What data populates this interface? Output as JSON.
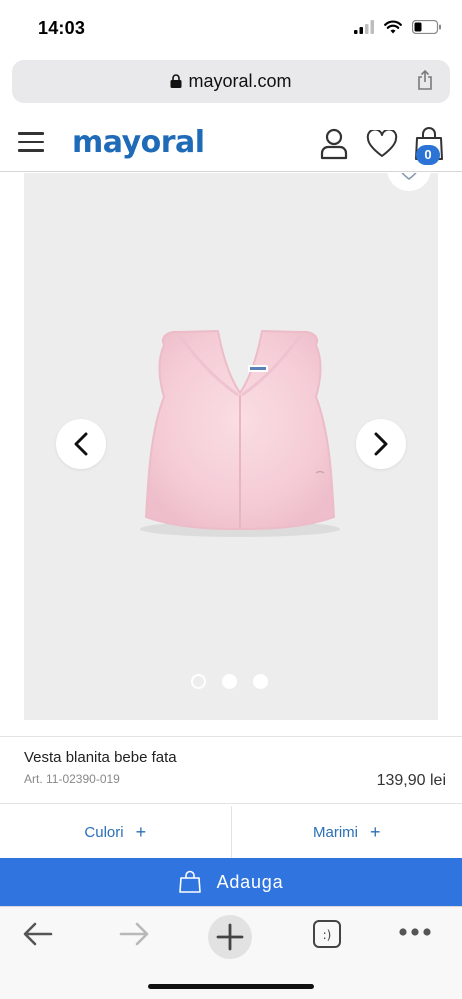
{
  "status_bar": {
    "time": "14:03"
  },
  "browser": {
    "url": "mayoral.com",
    "icons": {
      "lock": "lock-icon",
      "share": "share-icon"
    }
  },
  "header": {
    "logo": "mayoral",
    "bag_count": "0",
    "icons": {
      "menu": "hamburger-icon",
      "user": "user-icon",
      "favorites": "heart-icon",
      "bag": "shopping-bag-icon"
    }
  },
  "gallery": {
    "slide_count": 3,
    "active_slide": 1,
    "icons": {
      "prev": "chevron-left-icon",
      "next": "chevron-right-icon",
      "favorite": "heart-icon"
    }
  },
  "product": {
    "name": "Vesta blanita bebe fata",
    "article": "Art. 11-02390-019",
    "price": "139,90 lei"
  },
  "options": {
    "colors_label": "Culori",
    "sizes_label": "Marimi",
    "plus": "+"
  },
  "actions": {
    "add_label": "Adauga"
  },
  "toolbar": {
    "icons": [
      "back-arrow-icon",
      "forward-arrow-icon",
      "new-tab-plus-icon",
      "tabs-icon",
      "more-icon"
    ],
    "tabs_glyph": ":)"
  },
  "colors": {
    "brand_blue": "#1f6bb7",
    "button_blue": "#2f74df",
    "badge_blue": "#2b74d6",
    "gallery_bg": "#ededed",
    "vest_pink": "#f6cfd8"
  }
}
